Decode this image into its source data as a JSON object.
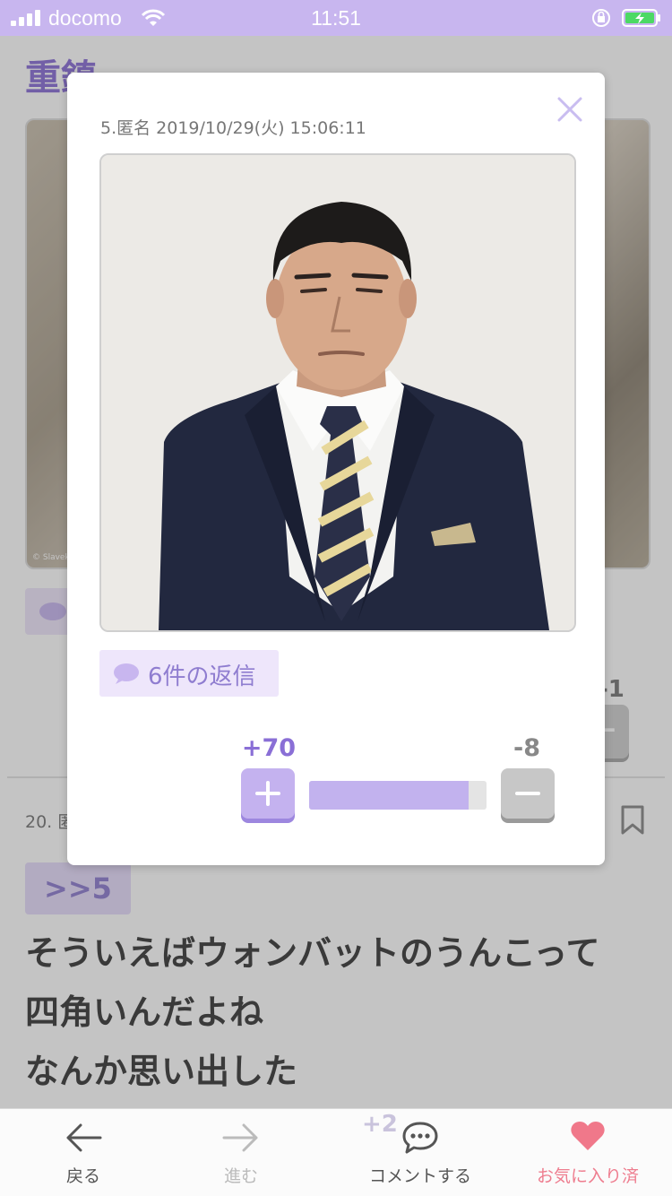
{
  "status_bar": {
    "carrier": "docomo",
    "time": "11:51",
    "icons": [
      "signal-icon",
      "wifi-icon",
      "orientation-lock-icon",
      "battery-charging-icon"
    ],
    "color": "#c8b6ef"
  },
  "background": {
    "page_title": "重鎮",
    "photo_credit": "© Slavek",
    "minus_count": "-1",
    "comment": {
      "meta": "20. 匿",
      "anchor": ">>5",
      "lines": [
        "そういえばウォンバットのうんこって",
        "四角いんだよね",
        "なんか思い出した"
      ]
    }
  },
  "modal": {
    "meta": "5.匿名 2019/10/29(火) 15:06:11",
    "replies_label": "6件の返信",
    "plus_count": "+70",
    "minus_count": "-8",
    "vote_ratio": 0.9,
    "accent_color": "#8a6fd6"
  },
  "toolbar": {
    "back_label": "戻る",
    "forward_label": "進む",
    "comment_label": "コメントする",
    "favorite_label": "お気に入り済",
    "ghost_count": "+2",
    "favorite_color": "#f0788a"
  }
}
